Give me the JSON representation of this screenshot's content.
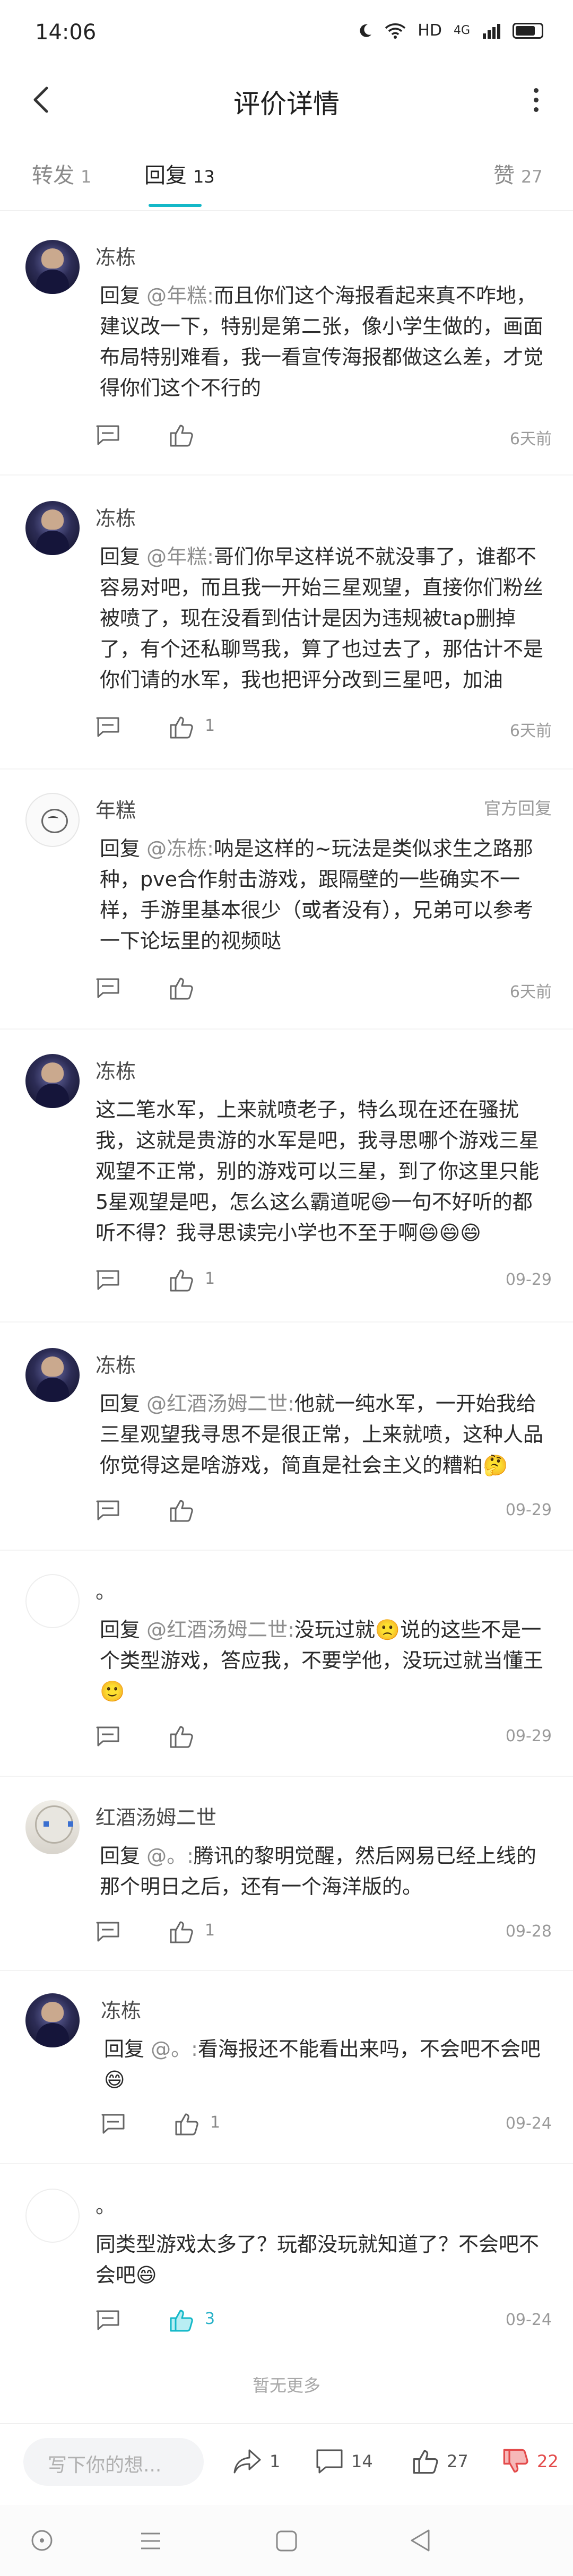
{
  "status_bar": {
    "time": "14:06",
    "network": "HD",
    "signal": "4G",
    "battery_icon": "battery-icon"
  },
  "header": {
    "title": "评价详情"
  },
  "tabs": [
    {
      "label": "转发",
      "count": "1"
    },
    {
      "label": "回复",
      "count": "13"
    },
    {
      "label": "赞",
      "count": "27"
    }
  ],
  "comments": [
    {
      "user": "冻栋",
      "tag": "",
      "reply_prefix": "回复 ",
      "mention": "@年糕:",
      "text": "而且你们这个海报看起来真不咋地，建议改一下，特别是第二张，像小学生做的，画面布局特别难看，我一看宣传海报都做这么差，才觉得你们这个不行的",
      "likes": "",
      "time": "6天前"
    },
    {
      "user": "冻栋",
      "tag": "",
      "reply_prefix": "回复 ",
      "mention": "@年糕:",
      "text": "哥们你早这样说不就没事了，谁都不容易对吧，而且我一开始三星观望，直接你们粉丝被喷了，现在没看到估计是因为违规被tap删掉了，有个还私聊骂我，算了也过去了，那估计不是你们请的水军，我也把评分改到三星吧，加油",
      "likes": "1",
      "time": "6天前"
    },
    {
      "user": "年糕",
      "tag": "官方回复",
      "reply_prefix": "回复 ",
      "mention": "@冻栋:",
      "text": "呐是这样的~玩法是类似求生之路那种，pve合作射击游戏，跟隔壁的一些确实不一样，手游里基本很少（或者没有），兄弟可以参考一下论坛里的视频哒",
      "likes": "",
      "time": "6天前"
    },
    {
      "user": "冻栋",
      "tag": "",
      "reply_prefix": "",
      "mention": "",
      "text": "这二笔水军，上来就喷老子，特么现在还在骚扰我，这就是贵游的水军是吧，我寻思哪个游戏三星观望不正常，别的游戏可以三星，到了你这里只能5星观望是吧，怎么这么霸道呢😄一句不好听的都听不得？我寻思读完小学也不至于啊😄😄😄",
      "likes": "1",
      "time": "09-29"
    },
    {
      "user": "冻栋",
      "tag": "",
      "reply_prefix": "回复 ",
      "mention": "@红酒汤姆二世:",
      "text": "他就一纯水军，一开始我给三星观望我寻思不是很正常，上来就喷，这种人品你觉得这是啥游戏，简直是社会主义的糟粕🤔",
      "likes": "",
      "time": "09-29"
    },
    {
      "user": "。",
      "tag": "",
      "reply_prefix": "回复 ",
      "mention": "@红酒汤姆二世:",
      "text": "没玩过就🙁说的这些不是一个类型游戏，答应我，不要学他，没玩过就当懂王🙂",
      "likes": "",
      "time": "09-29"
    },
    {
      "user": "红酒汤姆二世",
      "tag": "",
      "reply_prefix": "回复 ",
      "mention": "@。:",
      "text": "腾讯的黎明觉醒，然后网易已经上线的那个明日之后，还有一个海洋版的。",
      "likes": "1",
      "time": "09-28"
    },
    {
      "user": "冻栋",
      "tag": "",
      "reply_prefix": "回复 ",
      "mention": "@。:",
      "text": "看海报还不能看出来吗，不会吧不会吧😄",
      "likes": "1",
      "time": "09-24"
    },
    {
      "user": "。",
      "tag": "",
      "reply_prefix": "",
      "mention": "",
      "text": "同类型游戏太多了？玩都没玩就知道了？不会吧不会吧😄",
      "likes": "3",
      "time": "09-24"
    }
  ],
  "footer": {
    "no_more": "暂无更多"
  },
  "bottom_bar": {
    "input_placeholder": "写下你的想...",
    "share_count": "1",
    "comment_count": "14",
    "like_count": "27",
    "dislike_count": "22",
    "accent_color": "#14b8c8",
    "dislike_color": "#e34b4b"
  }
}
